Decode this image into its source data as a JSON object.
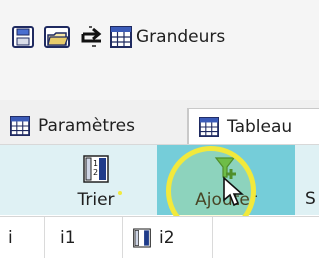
{
  "toolbar": {
    "grandeurs_label": "Grandeurs"
  },
  "tabs": {
    "parametres_label": "Paramètres",
    "tableau_label": "Tableau"
  },
  "ribbon": {
    "trier_label": "Trier",
    "ajouter_label": "Ajouter",
    "extra_label": "S"
  },
  "grid": {
    "headers": [
      "i",
      "i1",
      "i2"
    ]
  },
  "colors": {
    "highlight": "#f2e93c",
    "ribbon_bg": "#dff1f4",
    "ribbon_active": "#75cdd9"
  },
  "icons": [
    "save-icon",
    "open-folder-icon",
    "exchange-arrows-icon",
    "table-grid-icon",
    "sort-icon",
    "add-filter-icon",
    "mouse-pointer-icon"
  ]
}
